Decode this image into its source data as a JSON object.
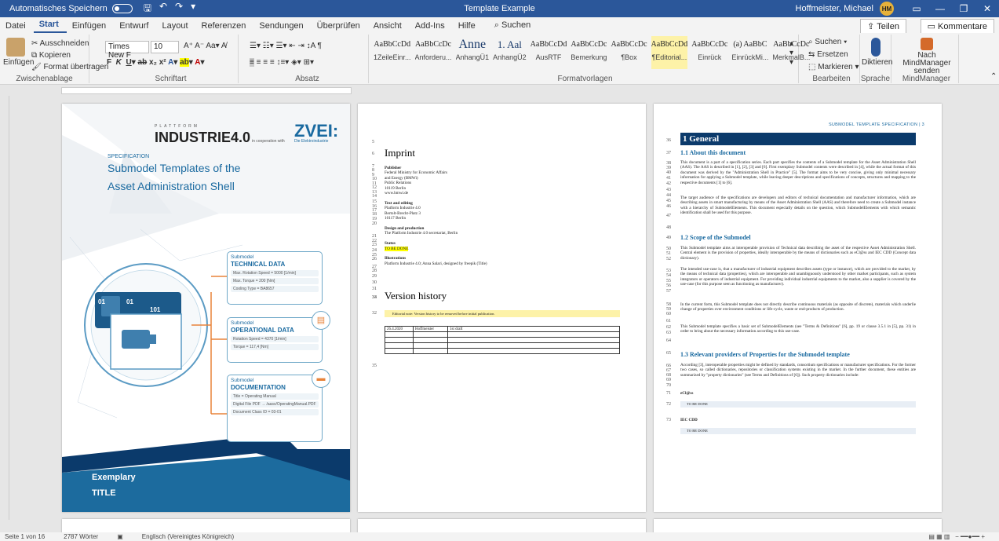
{
  "titlebar": {
    "autosave_label": "Automatisches Speichern",
    "title": "Template Example",
    "user": "Hoffmeister, Michael",
    "avatar_initials": "HM"
  },
  "menu": {
    "tabs": [
      "Datei",
      "Start",
      "Entwurf",
      "Einfügen",
      "Layout",
      "Referenzen",
      "Sendungen",
      "Überprüfen",
      "Ansicht",
      "Add-Ins",
      "Hilfe"
    ],
    "search": "Suchen",
    "share": "Teilen",
    "comments": "Kommentare"
  },
  "ribbon": {
    "clipboard": {
      "paste": "Einfügen",
      "cut": "Ausschneiden",
      "copy": "Kopieren",
      "format_painter": "Format übertragen",
      "group": "Zwischenablage"
    },
    "font": {
      "name": "Times New F",
      "size": "10",
      "group": "Schriftart"
    },
    "paragraph": {
      "group": "Absatz"
    },
    "styles": {
      "group": "Formatvorlagen",
      "items": [
        {
          "preview": "AaBbCcDd",
          "label": "1ZeileEinr..."
        },
        {
          "preview": "AaBbCcDc",
          "label": "Anforderu..."
        },
        {
          "preview": "Anne",
          "label": "AnhangÜ1"
        },
        {
          "preview": "1. Aal",
          "label": "AnhangÜ2"
        },
        {
          "preview": "AaBbCcDd",
          "label": "AusRTF"
        },
        {
          "preview": "AaBbCcDc",
          "label": "Bemerkung"
        },
        {
          "preview": "AaBbCcDc",
          "label": "¶Box"
        },
        {
          "preview": "AaBbCcDd",
          "label": "¶Editorial..."
        },
        {
          "preview": "AaBbCcDc",
          "label": "Einrück"
        },
        {
          "preview": "(a) AaBbC",
          "label": "EinrückMi..."
        },
        {
          "preview": "AaBbCcDc",
          "label": "MerkmalB..."
        }
      ]
    },
    "editing": {
      "find": "Suchen",
      "replace": "Ersetzen",
      "select": "Markieren",
      "group": "Bearbeiten"
    },
    "voice": {
      "dictate": "Diktieren",
      "group": "Sprache"
    },
    "mindmanager": {
      "send": "Nach MindManager senden",
      "group": "MindManager"
    }
  },
  "cover": {
    "logo1_small": "PLATTFORM",
    "logo1": "INDUSTRIE4.0",
    "cooperation": "in cooperation with",
    "logo2": "ZVEI:",
    "logo2_sub": "Die Elektroindustrie",
    "spec": "SPECIFICATION",
    "title_line1": "Submodel Templates of the",
    "title_line2": "Asset Administration Shell",
    "cards": [
      {
        "sm": "Submodel",
        "name": "TECHNICAL DATA",
        "items": [
          "Max. Rotation Speed = 5000 [1/min]",
          "Max. Torque = 200 [Nm]",
          "Cooling Type = BA8657"
        ]
      },
      {
        "sm": "Submodel",
        "name": "OPERATIONAL DATA",
        "items": [
          "Rotation Speed = 4370 [1/min]",
          "Torque = 117,4 [Nm]"
        ]
      },
      {
        "sm": "Submodel",
        "name": "DOCUMENTATION",
        "items": [
          "Title = Operating Manual",
          "Digital File PDF → /aasx/OperatingManual.PDF",
          "Document Class ID = 03-01"
        ]
      }
    ],
    "digits": [
      "01",
      "01",
      "101"
    ],
    "bottom1": "Exemplary",
    "bottom2": "TITLE"
  },
  "page2": {
    "imprint": "Imprint",
    "publisher_h": "Publisher",
    "publisher": [
      "Federal Ministry for Economic Affairs",
      "and Energy (BMWi)",
      "Public Relations",
      "10119 Berlin",
      "www.bmwi.de"
    ],
    "text_h": "Text and editing",
    "text": [
      "Platform Industrie 4.0",
      "Bertolt-Brecht-Platz 3",
      "10117 Berlin"
    ],
    "design_h": "Design and production",
    "design": "The Platform Industrie 4.0 secretariat, Berlin",
    "status_h": "Status",
    "status": "TO BE DONE",
    "illus_h": "Illustrations",
    "illus": "Platform Industrie 4.0; Anna Salari, designed by freepik (Title)",
    "version_history": "Version history",
    "editorial_note": "Editorial note: Version history to be removed before initial publication.",
    "vh_row": [
      "26.4.2020",
      "Hoffmeister",
      "1st draft"
    ],
    "line_numbers": [
      "5",
      "6",
      "7",
      "8",
      "9",
      "10",
      "11",
      "12",
      "13",
      "14",
      "15",
      "16",
      "17",
      "18",
      "19",
      "20",
      "21",
      "22",
      "23",
      "24",
      "25",
      "26",
      "27",
      "28",
      "29",
      "30",
      "31",
      "32",
      "33",
      "34",
      "35"
    ]
  },
  "page3": {
    "header": "SUBMODEL TEMPLATE SPECIFICATION | 3",
    "h1": "1   General",
    "h11": "1.1 About this document",
    "p1": "This document is a part of a specification series. Each part specifies the contents of a Submodel template for the Asset Administration Shell (AAS). The AAS is described in [1], [2], [3] and [6]. First exemplary Submodel contents were described in [4], while the actual format of this document was derived by the \"Administration Shell in Practice\" [5]. The format aims to be very concise, giving only minimal necessary information for applying a Submodel template, while leaving deeper descriptions and specifications of concepts, structures and mapping to the respective documents [1] to [6].",
    "p2": "The target audience of the specifications are developers and editors of technical documentation and manufacturer information, which are describing assets in smart manufacturing by means of the Asset Administration Shell (AAS) and therefore need to create a Submodel instance with a hierarchy of SubmodelElements. This document especially details on the question, which SubmodelElements with which semantic identification shall be used for this purpose.",
    "h12": "1.2 Scope of the Submodel",
    "p3": "This Submodel template aims at interoperable provision of Technical data describing the asset of the respective Asset Administration Shell. Central element is the provision of properties, ideally interoperable by the means of dictionaries such as eCl@ss and IEC CDD (Concept data dictionary).",
    "p4": "The intended use-case is, that a manufacturer of industrial equipment describes assets (type or instance), which are provided to the market, by the means of technical data (properties), which are interoperable and unambiguously understood by other market participants, such as system integrators or operators of industrial equipment. For providing individual industrial equipments to the market, also a supplier is covered by the use-case (for this purpose seen as functioning as manufacturer).",
    "p5": "In the current form, this Submodel template does not directly describe continuous materials (as opposite of discrete), materials which underlie change of properties over environment conditions or life-cycle, waste or end-products of production.",
    "p6": "This Submodel template specifies a basic set of SubmodelElements (see \"Terms & Definitions\" [6], pp. 19 or clause 3.5.1 in [5], pp. 31) in order to bring about the necessary information according to this use-case.",
    "h13": "1.3 Relevant providers of Properties for the Submodel template",
    "p7": "According [3], interoperable properties might be defined by standards, consortium specifications or manufacturer specifications. For the former two cases, so called dictionaries, repositories or classification systems existing in the market. In the further document, these entities are summarized by \"property dictionaries\" (see Terms and Definitions of [6]). Such property dictionaries include:",
    "eclass": "eCl@ss",
    "tbd": "TO BE DONE",
    "iec": "IEC CDD",
    "line_numbers": [
      "36",
      "37",
      "38",
      "39",
      "40",
      "41",
      "42",
      "43",
      "44",
      "45",
      "46",
      "47",
      "48",
      "49",
      "50",
      "51",
      "52",
      "53",
      "54",
      "55",
      "56",
      "57",
      "58",
      "59",
      "60",
      "61",
      "62",
      "63",
      "64",
      "65",
      "66",
      "67",
      "68",
      "69",
      "70",
      "71",
      "72",
      "73"
    ]
  },
  "status": {
    "page": "Seite 1 von 16",
    "words": "2787 Wörter",
    "language": "Englisch (Vereinigtes Königreich)"
  },
  "colors": {
    "word_blue": "#2b579a",
    "dark_navy": "#0b3a6b",
    "accent_orange": "#e8833a",
    "light_blue": "#1a6aa0"
  }
}
